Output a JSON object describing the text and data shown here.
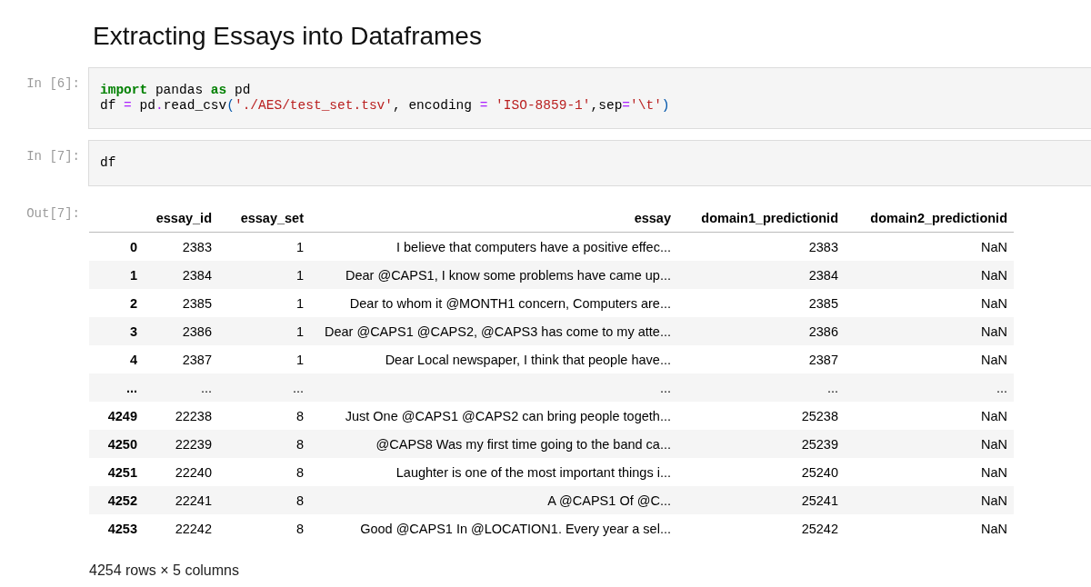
{
  "heading": "Extracting Essays into Dataframes",
  "cells": [
    {
      "prompt": "In [6]:",
      "lines": [
        [
          {
            "kind": "keyword",
            "text": "import"
          },
          {
            "kind": "plain",
            "text": " pandas "
          },
          {
            "kind": "keyword",
            "text": "as"
          },
          {
            "kind": "plain",
            "text": " pd"
          }
        ],
        [
          {
            "kind": "plain",
            "text": "df "
          },
          {
            "kind": "operator",
            "text": "="
          },
          {
            "kind": "plain",
            "text": " pd"
          },
          {
            "kind": "operator",
            "text": "."
          },
          {
            "kind": "plain",
            "text": "read_csv"
          },
          {
            "kind": "paren",
            "text": "("
          },
          {
            "kind": "string",
            "text": "'./AES/test_set.tsv'"
          },
          {
            "kind": "plain",
            "text": ", encoding "
          },
          {
            "kind": "operator",
            "text": "="
          },
          {
            "kind": "string",
            "text": " 'ISO-8859-1'"
          },
          {
            "kind": "plain",
            "text": ",sep"
          },
          {
            "kind": "operator",
            "text": "="
          },
          {
            "kind": "string",
            "text": "'\\t'"
          },
          {
            "kind": "paren",
            "text": ")"
          }
        ]
      ]
    },
    {
      "prompt": "In [7]:",
      "lines": [
        [
          {
            "kind": "plain",
            "text": "df"
          }
        ]
      ]
    }
  ],
  "output": {
    "prompt": "Out[7]:",
    "table": {
      "columns": [
        "essay_id",
        "essay_set",
        "essay",
        "domain1_predictionid",
        "domain2_predictionid"
      ],
      "rows": [
        {
          "index": "0",
          "cells": [
            "2383",
            "1",
            "I believe that computers have a positive effec...",
            "2383",
            "NaN"
          ]
        },
        {
          "index": "1",
          "cells": [
            "2384",
            "1",
            "Dear @CAPS1, I know some problems have came up...",
            "2384",
            "NaN"
          ]
        },
        {
          "index": "2",
          "cells": [
            "2385",
            "1",
            "Dear to whom it @MONTH1 concern, Computers are...",
            "2385",
            "NaN"
          ]
        },
        {
          "index": "3",
          "cells": [
            "2386",
            "1",
            "Dear @CAPS1 @CAPS2, @CAPS3 has come to my atte...",
            "2386",
            "NaN"
          ]
        },
        {
          "index": "4",
          "cells": [
            "2387",
            "1",
            "Dear Local newspaper, I think that people have...",
            "2387",
            "NaN"
          ]
        },
        {
          "index": "...",
          "cells": [
            "...",
            "...",
            "...",
            "...",
            "..."
          ]
        },
        {
          "index": "4249",
          "cells": [
            "22238",
            "8",
            "Just One @CAPS1 @CAPS2 can bring people togeth...",
            "25238",
            "NaN"
          ]
        },
        {
          "index": "4250",
          "cells": [
            "22239",
            "8",
            "@CAPS8 Was my first time going to the band ca...",
            "25239",
            "NaN"
          ]
        },
        {
          "index": "4251",
          "cells": [
            "22240",
            "8",
            "Laughter is one of the most important things i...",
            "25240",
            "NaN"
          ]
        },
        {
          "index": "4252",
          "cells": [
            "22241",
            "8",
            "A @CAPS1 Of @C...",
            "25241",
            "NaN"
          ]
        },
        {
          "index": "4253",
          "cells": [
            "22242",
            "8",
            "Good @CAPS1 In @LOCATION1. Every year a sel...",
            "25242",
            "NaN"
          ]
        }
      ]
    },
    "summary": "4254 rows × 5 columns"
  }
}
